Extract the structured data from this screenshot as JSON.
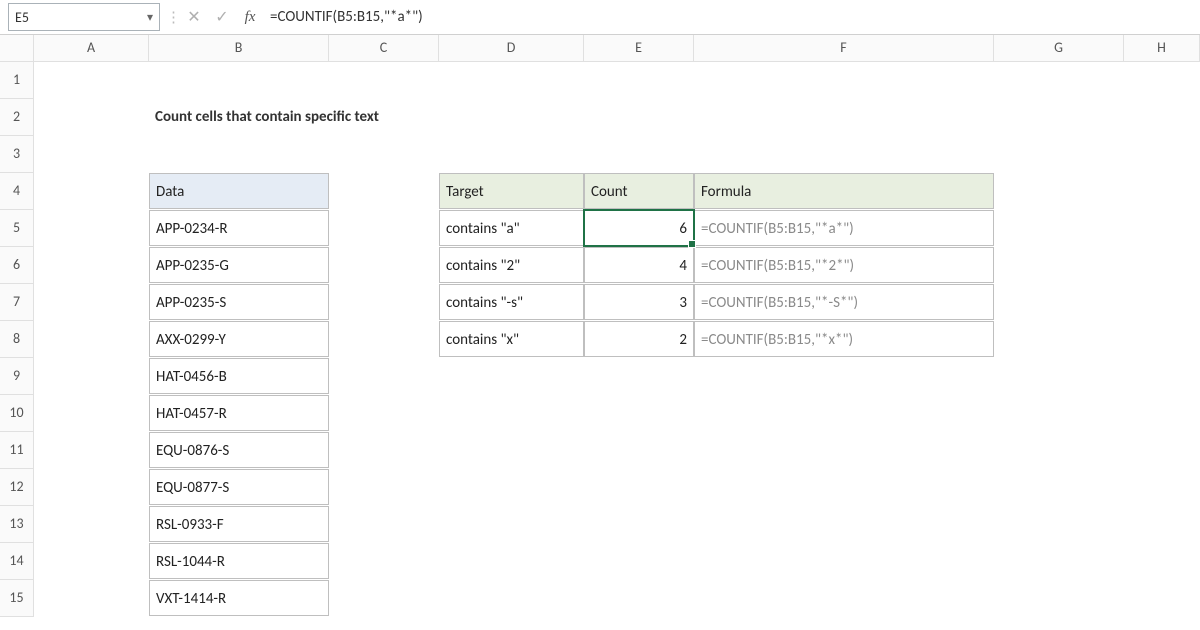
{
  "nameBox": {
    "value": "E5"
  },
  "formulaBar": {
    "formula": "=COUNTIF(B5:B15,\"*a*\")"
  },
  "columns": [
    "A",
    "B",
    "C",
    "D",
    "E",
    "F",
    "G",
    "H"
  ],
  "rows": [
    "1",
    "2",
    "3",
    "4",
    "5",
    "6",
    "7",
    "8",
    "9",
    "10",
    "11",
    "12",
    "13",
    "14",
    "15"
  ],
  "title": "Count cells that contain specific text",
  "dataHeader": "Data",
  "dataValues": [
    "APP-0234-R",
    "APP-0235-G",
    "APP-0235-S",
    "AXX-0299-Y",
    "HAT-0456-B",
    "HAT-0457-R",
    "EQU-0876-S",
    "EQU-0877-S",
    "RSL-0933-F",
    "RSL-1044-R",
    "VXT-1414-R"
  ],
  "resultHeaders": {
    "target": "Target",
    "count": "Count",
    "formula": "Formula"
  },
  "results": [
    {
      "target": "contains \"a\"",
      "count": "6",
      "formula": "=COUNTIF(B5:B15,\"*a*\")"
    },
    {
      "target": "contains \"2\"",
      "count": "4",
      "formula": "=COUNTIF(B5:B15,\"*2*\")"
    },
    {
      "target": "contains \"-s\"",
      "count": "3",
      "formula": "=COUNTIF(B5:B15,\"*-S*\")"
    },
    {
      "target": "contains \"x\"",
      "count": "2",
      "formula": "=COUNTIF(B5:B15,\"*x*\")"
    }
  ],
  "chart_data": {
    "type": "table",
    "title": "Count cells that contain specific text",
    "data_column": [
      "APP-0234-R",
      "APP-0235-G",
      "APP-0235-S",
      "AXX-0299-Y",
      "HAT-0456-B",
      "HAT-0457-R",
      "EQU-0876-S",
      "EQU-0877-S",
      "RSL-0933-F",
      "RSL-1044-R",
      "VXT-1414-R"
    ],
    "results": [
      {
        "target": "contains \"a\"",
        "count": 6,
        "formula": "=COUNTIF(B5:B15,\"*a*\")"
      },
      {
        "target": "contains \"2\"",
        "count": 4,
        "formula": "=COUNTIF(B5:B15,\"*2*\")"
      },
      {
        "target": "contains \"-s\"",
        "count": 3,
        "formula": "=COUNTIF(B5:B15,\"*-S*\")"
      },
      {
        "target": "contains \"x\"",
        "count": 2,
        "formula": "=COUNTIF(B5:B15,\"*x*\")"
      }
    ]
  }
}
